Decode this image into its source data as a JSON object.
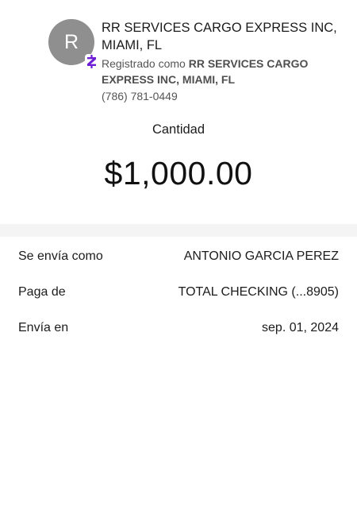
{
  "recipient": {
    "avatar_initial": "R",
    "badge_icon": "zelle-icon",
    "name_line1": "RR SERVICES CARGO EXPRESS INC,",
    "name_line2": "MIAMI, FL",
    "registered_prefix": "Registrado como ",
    "registered_name": "RR SERVICES CARGO EXPRESS INC, MIAMI, FL",
    "phone": "(786) 781-0449"
  },
  "amount": {
    "label": "Cantidad",
    "value": "$1,000.00"
  },
  "details": [
    {
      "label": "Se envía como",
      "value": "ANTONIO GARCIA PEREZ"
    },
    {
      "label": "Paga de",
      "value": "TOTAL CHECKING (...8905)"
    },
    {
      "label": "Envía en",
      "value": "sep. 01, 2024"
    }
  ],
  "colors": {
    "avatar_bg": "#8f8f8f",
    "zelle_purple": "#6d1ed4",
    "divider_band": "#f4f4f4"
  }
}
